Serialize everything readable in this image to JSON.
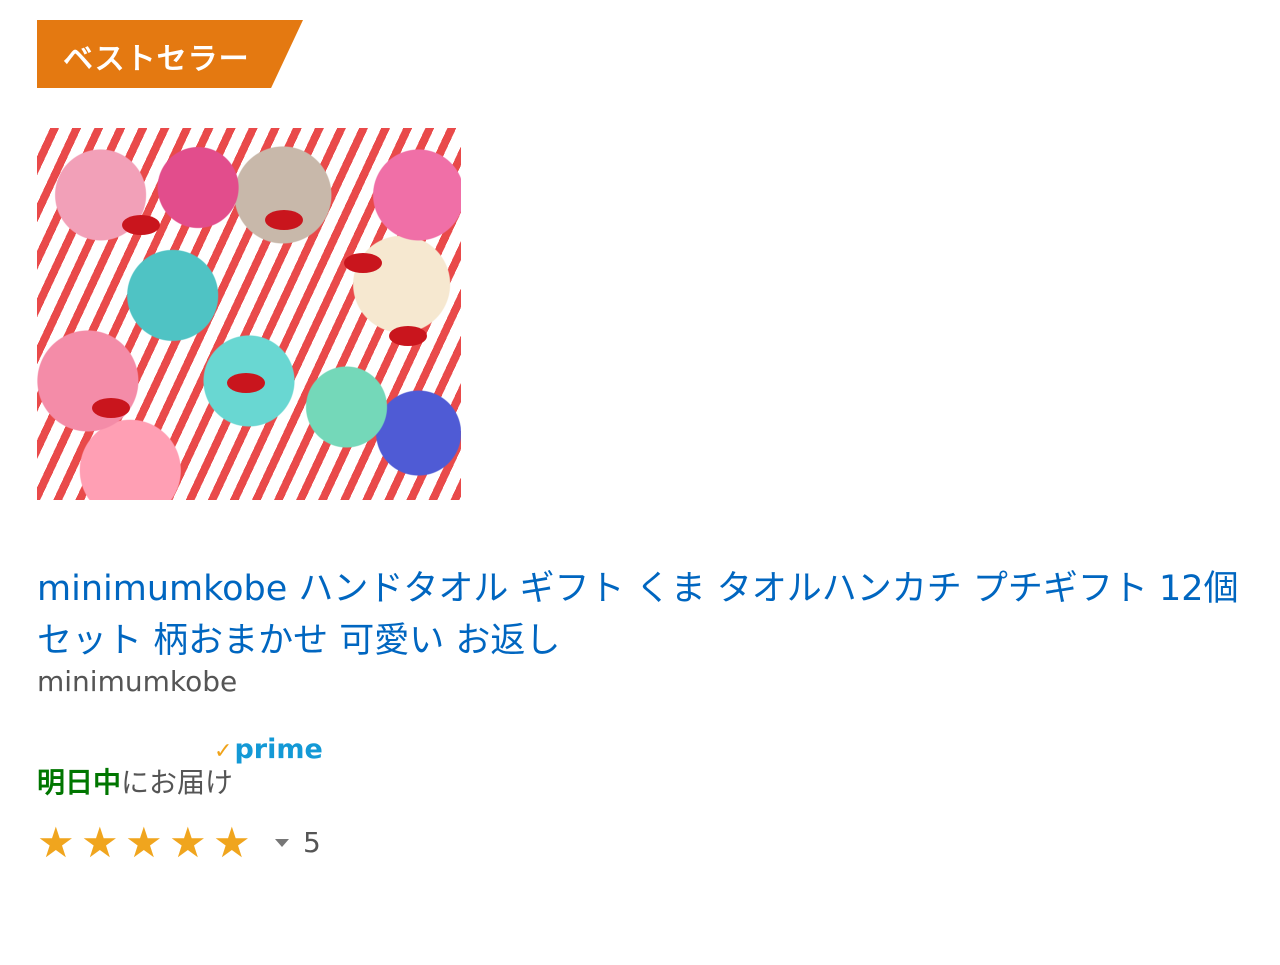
{
  "badge": {
    "label": "ベストセラー"
  },
  "product": {
    "title": "minimumkobe ハンドタオル ギフト くま タオルハンカチ プチギフト 12個 セット 柄おまかせ 可愛い お返し",
    "seller": "minimumkobe",
    "image_icon": "product-photo",
    "prime": "prime",
    "delivery_day": "明日中",
    "delivery_suffix": "にお届け",
    "rating": 5,
    "rating_stars": [
      "★",
      "★",
      "★",
      "★",
      "★"
    ],
    "review_count": "5"
  },
  "colors": {
    "badge": "#e47911",
    "title": "#0066c0",
    "delivery": "#007600",
    "prime": "#1399d6",
    "stars": "#f0a51e"
  }
}
